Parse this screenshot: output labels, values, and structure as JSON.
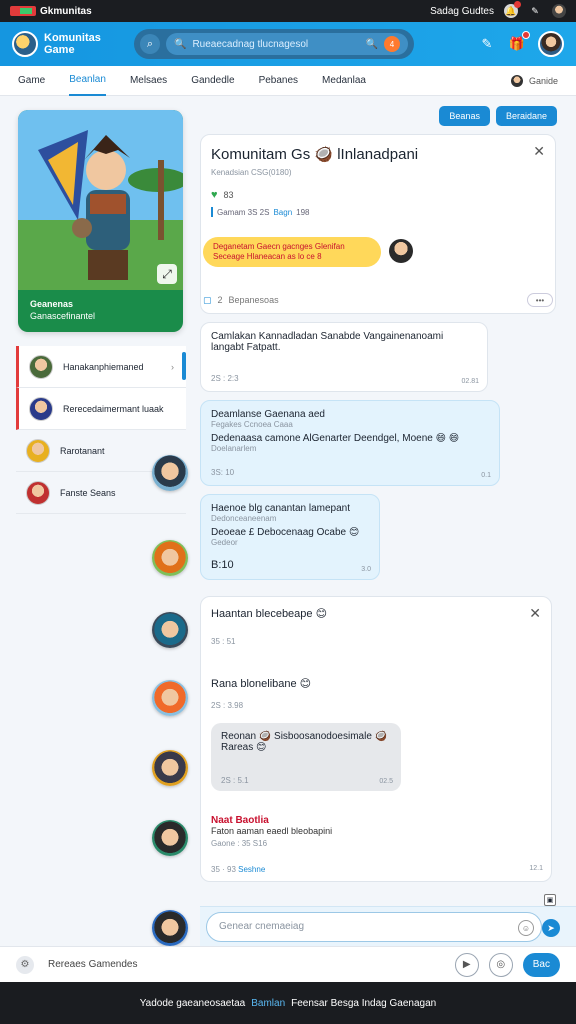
{
  "status_bar": {
    "title": "Gkmunitas",
    "right_label": "Sadag Gudtes"
  },
  "app_bar": {
    "brand_line1": "Komunitas",
    "brand_line2": "Game",
    "search_placeholder": "Rueaecadnag tlucnagesol",
    "search_badge": "4"
  },
  "nav": {
    "tabs": [
      "Game",
      "Beanlan",
      "Melsaes",
      "Gandedle",
      "Pebanes",
      "Medanlaa"
    ],
    "active_index": 1,
    "right_label": "Ganide"
  },
  "game_card": {
    "title": "Geanenas",
    "subtitle": "Ganascefinantel"
  },
  "sidebar": {
    "items": [
      {
        "label": "Hanakanphiemaned"
      },
      {
        "label": "Rerecedaimermant luaak"
      },
      {
        "label": "Rarotanant"
      },
      {
        "label": "Fanste Seans"
      }
    ]
  },
  "top_buttons": {
    "left": "Beanas",
    "right": "Beraidane"
  },
  "post": {
    "title": "Komunitam Gs 🥥 lInlanadpani",
    "subtitle": "Kenadsian CSG(0180)",
    "likes": "83",
    "meta_left": "Gamam 3S 2S",
    "meta_badge": "Bagn",
    "meta_right": "198",
    "pill_text": "Deganetam Gaecn gacnges Glenifan Seceage Hlaneacan as lo ce 8",
    "footer_count": "2",
    "footer_label": "Bepanesoas",
    "more": "•••"
  },
  "messages": [
    {
      "text": "Camlakan Kannadladan Sanabde Vangainenanoami langabt Fatpatt.",
      "time": "2S : 2:3",
      "right": "02.81"
    },
    {
      "title": "Deamlanse Gaenana aed",
      "sub": "Fegakes Ccnoea Caaa",
      "text": "Dedenaasa camone AlGenarter Deendgel, Moene 😄 😄",
      "sub2": "Doelanarlem",
      "time": "3S: 10",
      "right": "0.1"
    },
    {
      "title": "Haenoe blg canantan lamepant",
      "sub": "Dedonceaneenam",
      "text": "Deoeae £ Debocenaag Ocabe 😊",
      "sub2": "Gedeor",
      "time": "B:10",
      "right": "3.0"
    }
  ],
  "chat_panel": {
    "line1": "Haantan blecebeape 😊",
    "time1": "35 : 51",
    "line2": "Rana blonelibane 😊",
    "time2": "2S : 3.98",
    "gray_text": "Reonan 🥥 Sisboosanodoesimale 🥥",
    "gray_sub": "Rareas 😊",
    "gray_time": "2S : 5.1",
    "gray_right": "02.5",
    "red_title": "Naat Baotlia",
    "red_sub": "Faton aaman eaedl bleobapini",
    "red_time": "Gaone : 35 S16",
    "foot_time": "35 · 93",
    "foot_link": "Seshne",
    "foot_right": "12.1"
  },
  "composer": {
    "placeholder": "Genear cnemaeiag"
  },
  "bottom_bar": {
    "label": "Rereaes Gamendes",
    "go": "Bac"
  },
  "footer": {
    "left": "Yadode gaeaneosaetaa",
    "highlight": "Bamlan",
    "right": "Feensar Besga Indag Gaenagan"
  }
}
